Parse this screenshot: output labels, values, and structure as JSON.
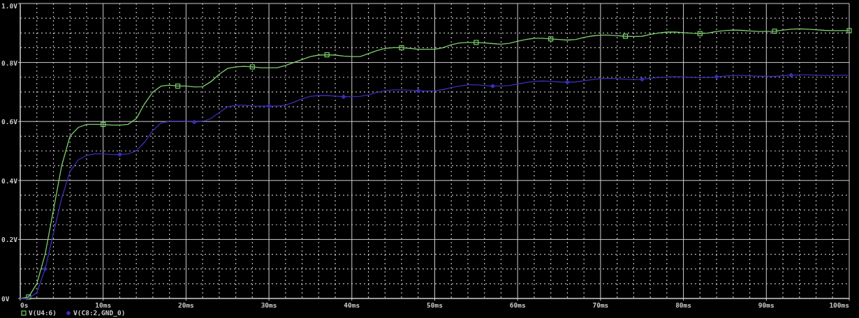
{
  "plot": {
    "chart_data": {
      "type": "line",
      "grid": true,
      "legend": true,
      "x": [
        0,
        1,
        2,
        3,
        4,
        5,
        6,
        7,
        8,
        9,
        10,
        11,
        12,
        13,
        14,
        15,
        16,
        17,
        18,
        19,
        20,
        21,
        22,
        23,
        24,
        25,
        26,
        27,
        28,
        29,
        30,
        31,
        32,
        33,
        34,
        35,
        36,
        37,
        38,
        39,
        40,
        41,
        42,
        43,
        44,
        45,
        46,
        47,
        48,
        49,
        50,
        51,
        52,
        53,
        54,
        55,
        56,
        57,
        58,
        59,
        60,
        61,
        62,
        63,
        64,
        65,
        66,
        67,
        68,
        69,
        70,
        71,
        72,
        73,
        74,
        75,
        76,
        77,
        78,
        79,
        80,
        81,
        82,
        83,
        84,
        85,
        86,
        87,
        88,
        89,
        90,
        91,
        92,
        93,
        94,
        95,
        96,
        97,
        98,
        99,
        100
      ],
      "series": [
        {
          "name": "V(U4:6)",
          "color": "#7ccf6c",
          "values": [
            0,
            0.005,
            0.05,
            0.15,
            0.3,
            0.45,
            0.55,
            0.58,
            0.59,
            0.59,
            0.59,
            0.588,
            0.588,
            0.59,
            0.61,
            0.66,
            0.7,
            0.72,
            0.723,
            0.72,
            0.72,
            0.717,
            0.718,
            0.735,
            0.76,
            0.78,
            0.785,
            0.787,
            0.785,
            0.782,
            0.782,
            0.782,
            0.79,
            0.8,
            0.81,
            0.82,
            0.825,
            0.826,
            0.825,
            0.822,
            0.82,
            0.82,
            0.83,
            0.84,
            0.848,
            0.85,
            0.85,
            0.848,
            0.845,
            0.845,
            0.845,
            0.85,
            0.86,
            0.866,
            0.868,
            0.868,
            0.866,
            0.864,
            0.862,
            0.865,
            0.872,
            0.878,
            0.882,
            0.882,
            0.88,
            0.878,
            0.876,
            0.878,
            0.885,
            0.89,
            0.893,
            0.893,
            0.891,
            0.889,
            0.888,
            0.889,
            0.895,
            0.9,
            0.903,
            0.903,
            0.901,
            0.899,
            0.898,
            0.9,
            0.905,
            0.908,
            0.91,
            0.909,
            0.907,
            0.905,
            0.905,
            0.906,
            0.91,
            0.913,
            0.914,
            0.913,
            0.911,
            0.909,
            0.908,
            0.908,
            0.908
          ]
        },
        {
          "name": "V(C8:2,GND_0)",
          "color": "#3a2fb8",
          "values": [
            0,
            0,
            0.02,
            0.1,
            0.22,
            0.34,
            0.43,
            0.47,
            0.485,
            0.49,
            0.49,
            0.488,
            0.488,
            0.49,
            0.5,
            0.53,
            0.57,
            0.595,
            0.6,
            0.6,
            0.6,
            0.598,
            0.6,
            0.61,
            0.63,
            0.65,
            0.655,
            0.655,
            0.653,
            0.652,
            0.652,
            0.652,
            0.655,
            0.665,
            0.677,
            0.685,
            0.688,
            0.688,
            0.686,
            0.684,
            0.684,
            0.685,
            0.69,
            0.698,
            0.704,
            0.707,
            0.707,
            0.706,
            0.704,
            0.703,
            0.704,
            0.708,
            0.715,
            0.72,
            0.724,
            0.724,
            0.722,
            0.72,
            0.72,
            0.722,
            0.727,
            0.732,
            0.736,
            0.737,
            0.736,
            0.734,
            0.733,
            0.734,
            0.738,
            0.742,
            0.745,
            0.746,
            0.745,
            0.743,
            0.742,
            0.743,
            0.746,
            0.749,
            0.751,
            0.752,
            0.751,
            0.75,
            0.749,
            0.749,
            0.751,
            0.754,
            0.756,
            0.756,
            0.755,
            0.754,
            0.753,
            0.753,
            0.755,
            0.757,
            0.758,
            0.758,
            0.757,
            0.756,
            0.756,
            0.757,
            0.757
          ]
        }
      ],
      "xlim": [
        0,
        100
      ],
      "ylim": [
        0,
        1
      ],
      "xticks": [
        {
          "value": 0,
          "label": "0s"
        },
        {
          "value": 10,
          "label": "10ms"
        },
        {
          "value": 20,
          "label": "20ms"
        },
        {
          "value": 30,
          "label": "30ms"
        },
        {
          "value": 40,
          "label": "40ms"
        },
        {
          "value": 50,
          "label": "50ms"
        },
        {
          "value": 60,
          "label": "60ms"
        },
        {
          "value": 70,
          "label": "70ms"
        },
        {
          "value": 80,
          "label": "80ms"
        },
        {
          "value": 90,
          "label": "90ms"
        },
        {
          "value": 100,
          "label": "100ms"
        }
      ],
      "yticks": [
        {
          "value": 0,
          "label": "0V"
        },
        {
          "value": 0.2,
          "label": "0.2V"
        },
        {
          "value": 0.4,
          "label": "0.4V"
        },
        {
          "value": 0.6,
          "label": "0.6V"
        },
        {
          "value": 0.8,
          "label": "0.8V"
        },
        {
          "value": 1,
          "label": "1.0V"
        }
      ]
    }
  }
}
